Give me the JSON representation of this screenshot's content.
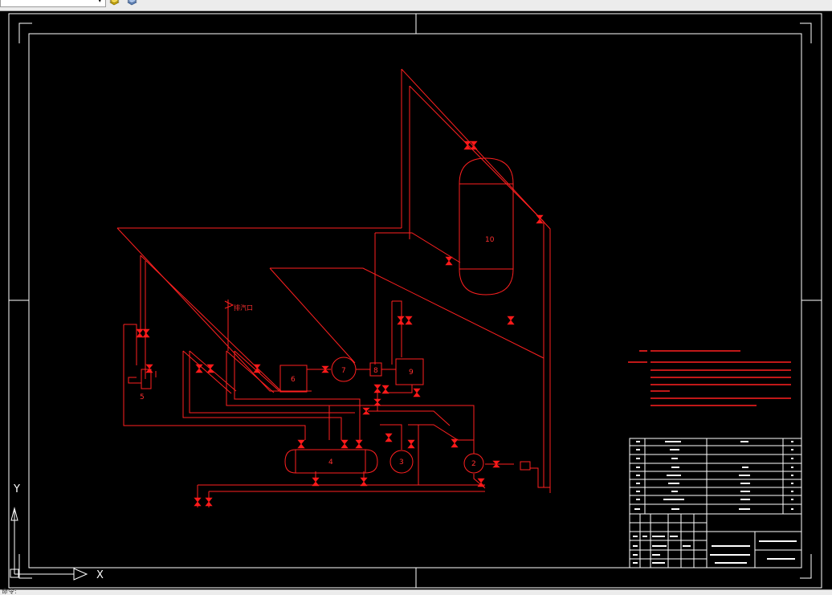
{
  "toolbar": {
    "combo_value": "",
    "icons": [
      "layer-stack-icon",
      "layer-properties-icon"
    ]
  },
  "statusbar": {
    "command_text": "命令:"
  },
  "colors": {
    "background": "#000000",
    "pipeline": "#ff2020",
    "valve": "#ff1a1a",
    "frame": "#ffffff",
    "ucs": "#ffffff"
  },
  "equipment": [
    {
      "id": "2",
      "label": "2"
    },
    {
      "id": "3",
      "label": "3"
    },
    {
      "id": "4",
      "label": "4"
    },
    {
      "id": "5",
      "label": "5"
    },
    {
      "id": "6",
      "label": "6"
    },
    {
      "id": "7",
      "label": "7"
    },
    {
      "id": "8",
      "label": "8"
    },
    {
      "id": "9",
      "label": "9"
    },
    {
      "id": "10",
      "label": "10"
    }
  ],
  "exhaust_label": "排汽口",
  "ucs": {
    "x_label": "X",
    "y_label": "Y"
  }
}
